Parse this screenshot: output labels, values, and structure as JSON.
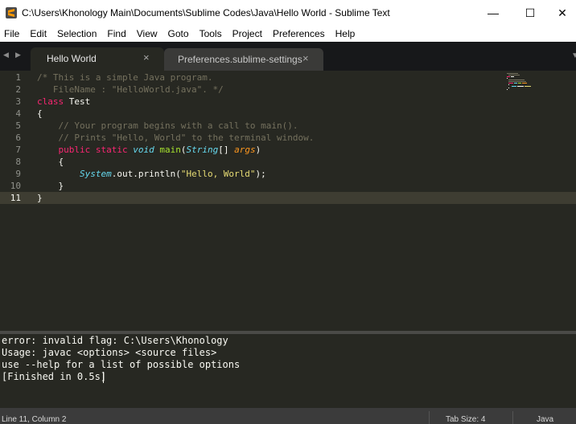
{
  "window": {
    "title": "C:\\Users\\Khonology Main\\Documents\\Sublime Codes\\Java\\Hello World - Sublime Text",
    "minimize_glyph": "—",
    "maximize_glyph": "☐",
    "close_glyph": "✕",
    "app_icon": "sublime-text-logo",
    "accent_color": "#ff9800"
  },
  "menu": {
    "items": [
      "File",
      "Edit",
      "Selection",
      "Find",
      "View",
      "Goto",
      "Tools",
      "Project",
      "Preferences",
      "Help"
    ]
  },
  "tabs": {
    "nav_left_glyph": "◀",
    "nav_right_glyph": "▶",
    "overflow_glyph": "▼",
    "items": [
      {
        "label": "Hello World",
        "close_glyph": "×",
        "active": true
      },
      {
        "label": "Preferences.sublime-settings",
        "close_glyph": "×",
        "active": false
      }
    ]
  },
  "editor": {
    "active_line": 11,
    "line_numbers": [
      "1",
      "2",
      "3",
      "4",
      "5",
      "6",
      "7",
      "8",
      "9",
      "10",
      "11"
    ],
    "lines": [
      [
        {
          "t": "comment",
          "v": "/* This is a simple Java program."
        }
      ],
      [
        {
          "t": "comment",
          "v": "   FileName : \"HelloWorld.java\". */"
        }
      ],
      [
        {
          "t": "kw",
          "v": "class"
        },
        {
          "t": "plain",
          "v": " Test"
        }
      ],
      [
        {
          "t": "plain",
          "v": "{"
        }
      ],
      [
        {
          "t": "comment",
          "v": "    // Your program begins with a call to main()."
        }
      ],
      [
        {
          "t": "comment",
          "v": "    // Prints \"Hello, World\" to the terminal window."
        }
      ],
      [
        {
          "t": "plain",
          "v": "    "
        },
        {
          "t": "kw",
          "v": "public"
        },
        {
          "t": "plain",
          "v": " "
        },
        {
          "t": "kw",
          "v": "static"
        },
        {
          "t": "plain",
          "v": " "
        },
        {
          "t": "type",
          "v": "void"
        },
        {
          "t": "plain",
          "v": " "
        },
        {
          "t": "fn",
          "v": "main"
        },
        {
          "t": "plain",
          "v": "("
        },
        {
          "t": "type",
          "v": "String"
        },
        {
          "t": "plain",
          "v": "[] "
        },
        {
          "t": "arg",
          "v": "args"
        },
        {
          "t": "plain",
          "v": ")"
        }
      ],
      [
        {
          "t": "plain",
          "v": "    {"
        }
      ],
      [
        {
          "t": "plain",
          "v": "        "
        },
        {
          "t": "type",
          "v": "System"
        },
        {
          "t": "plain",
          "v": ".out.println("
        },
        {
          "t": "str",
          "v": "\"Hello, World\""
        },
        {
          "t": "plain",
          "v": ");"
        }
      ],
      [
        {
          "t": "plain",
          "v": "    }"
        }
      ],
      [
        {
          "t": "plain",
          "v": "}"
        }
      ]
    ]
  },
  "output": {
    "lines": [
      "error: invalid flag: C:\\Users\\Khonology",
      "Usage: javac <options> <source files>",
      "use --help for a list of possible options",
      "[Finished in 0.5s]"
    ]
  },
  "status": {
    "position": "Line 11, Column 2",
    "tab_size": "Tab Size: 4",
    "syntax": "Java"
  }
}
